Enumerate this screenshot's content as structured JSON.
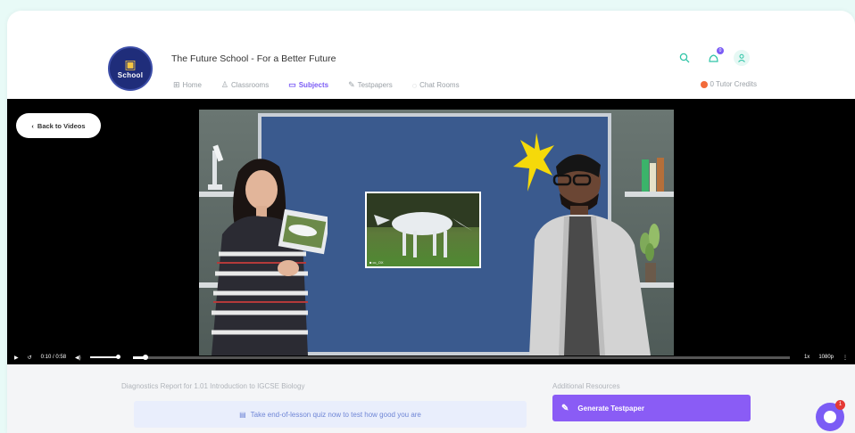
{
  "header": {
    "logo_text": "School",
    "site_title": "The Future School - For a Better Future",
    "nav": [
      {
        "label": "Home",
        "icon": "home-icon",
        "glyph": "⊞"
      },
      {
        "label": "Classrooms",
        "icon": "classroom-icon",
        "glyph": "♙"
      },
      {
        "label": "Subjects",
        "icon": "book-icon",
        "glyph": "▭",
        "active": true
      },
      {
        "label": "Testpapers",
        "icon": "testpaper-icon",
        "glyph": "✎"
      },
      {
        "label": "Chat Rooms",
        "icon": "chat-icon",
        "glyph": "◌"
      }
    ],
    "notification_count": "0",
    "credits_label": "0 Tutor Credits"
  },
  "video": {
    "back_label": "Back to Videos",
    "photo_caption": "■ cc_OX",
    "time_current": "0:10",
    "time_separator": "/",
    "time_total": "0:58",
    "progress": 0.02,
    "volume": 1.0,
    "speed": "1x",
    "quality": "1080p"
  },
  "bottom": {
    "diagnostics_title": "Diagnostics Report for 1.01 Introduction to IGCSE Biology",
    "quiz_text": "Take end-of-lesson quiz now to test how good you are",
    "resources_title": "Additional Resources",
    "generate_label": "Generate Testpaper"
  },
  "chat_badge": "1",
  "colors": {
    "accent": "#7b5cf5",
    "teal": "#2ec4a6",
    "background": "#e8faf7"
  }
}
